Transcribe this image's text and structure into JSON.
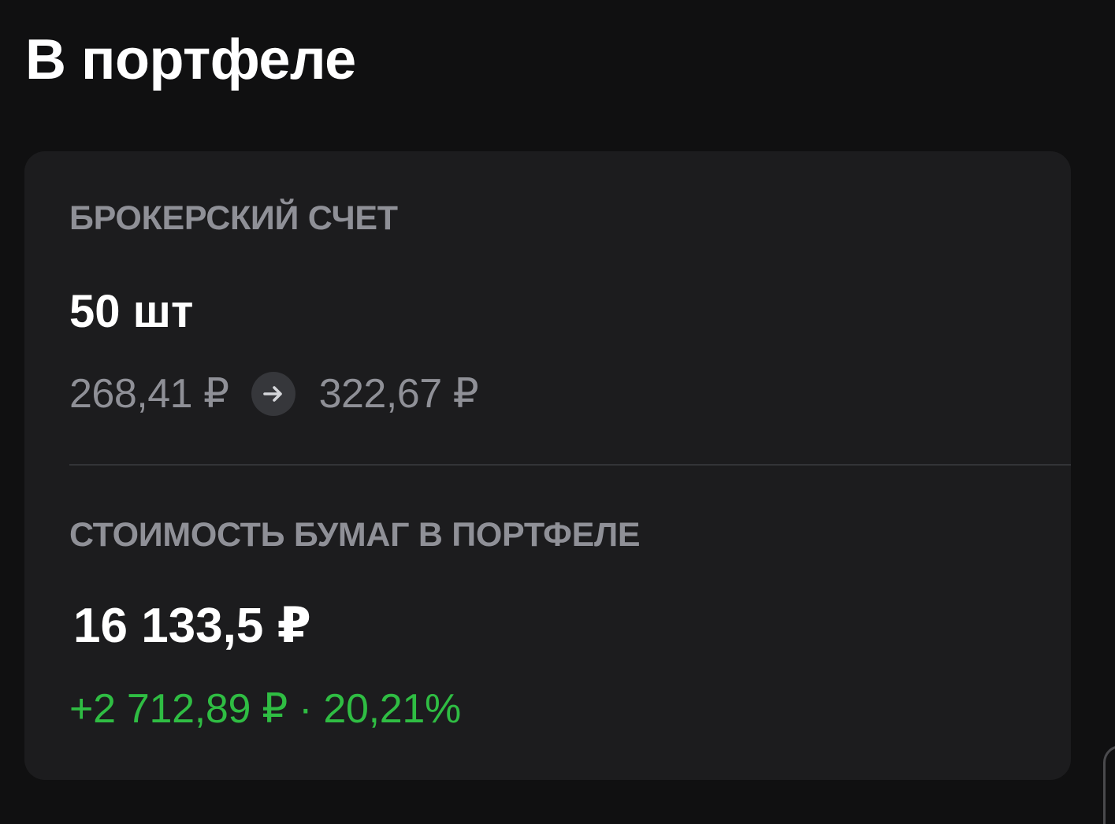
{
  "header": {
    "title": "В портфеле"
  },
  "card": {
    "account_label": "БРОКЕРСКИЙ СЧЕТ",
    "quantity": "50 шт",
    "price_from": "268,41 ₽",
    "price_to": "322,67 ₽",
    "arrow_icon": "arrow-right-icon",
    "value_label": "СТОИМОСТЬ БУМАГ В ПОРТФЕЛЕ",
    "total_value": "16 133,5 ₽",
    "change": "+2 712,89 ₽ · 20,21%"
  },
  "colors": {
    "background": "#101011",
    "card": "#1c1c1e",
    "primary_text": "#ffffff",
    "secondary_text": "#8f9097",
    "positive": "#2fbd43"
  }
}
